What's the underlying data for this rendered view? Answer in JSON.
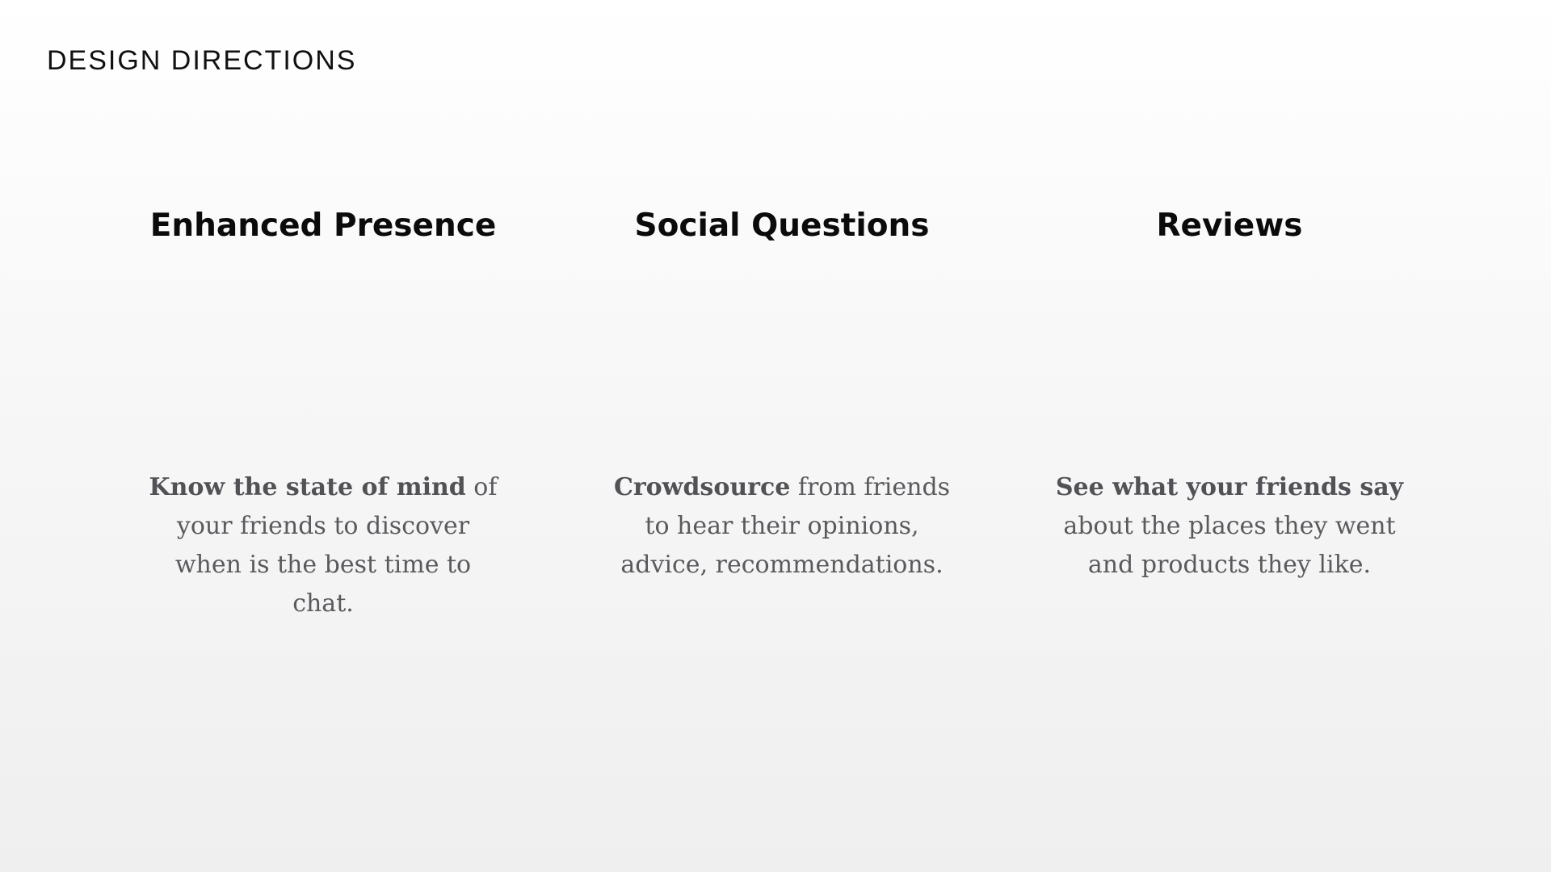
{
  "header": {
    "label": "DESIGN DIRECTIONS"
  },
  "directions": [
    {
      "title": "Enhanced Presence",
      "bold": "Know the state of mind",
      "rest": " of your friends to discover when is the best time to chat."
    },
    {
      "title": "Social Questions",
      "bold": "Crowdsource",
      "rest": " from friends to hear their opinions, advice, recommendations."
    },
    {
      "title": "Reviews",
      "bold": "See what your friends say",
      "rest": " about the places they went and products they like."
    }
  ],
  "colors": {
    "title": "#0b0b0b",
    "body": "#5a5a5e",
    "background_top": "#ffffff",
    "background_bottom": "#efefef"
  }
}
